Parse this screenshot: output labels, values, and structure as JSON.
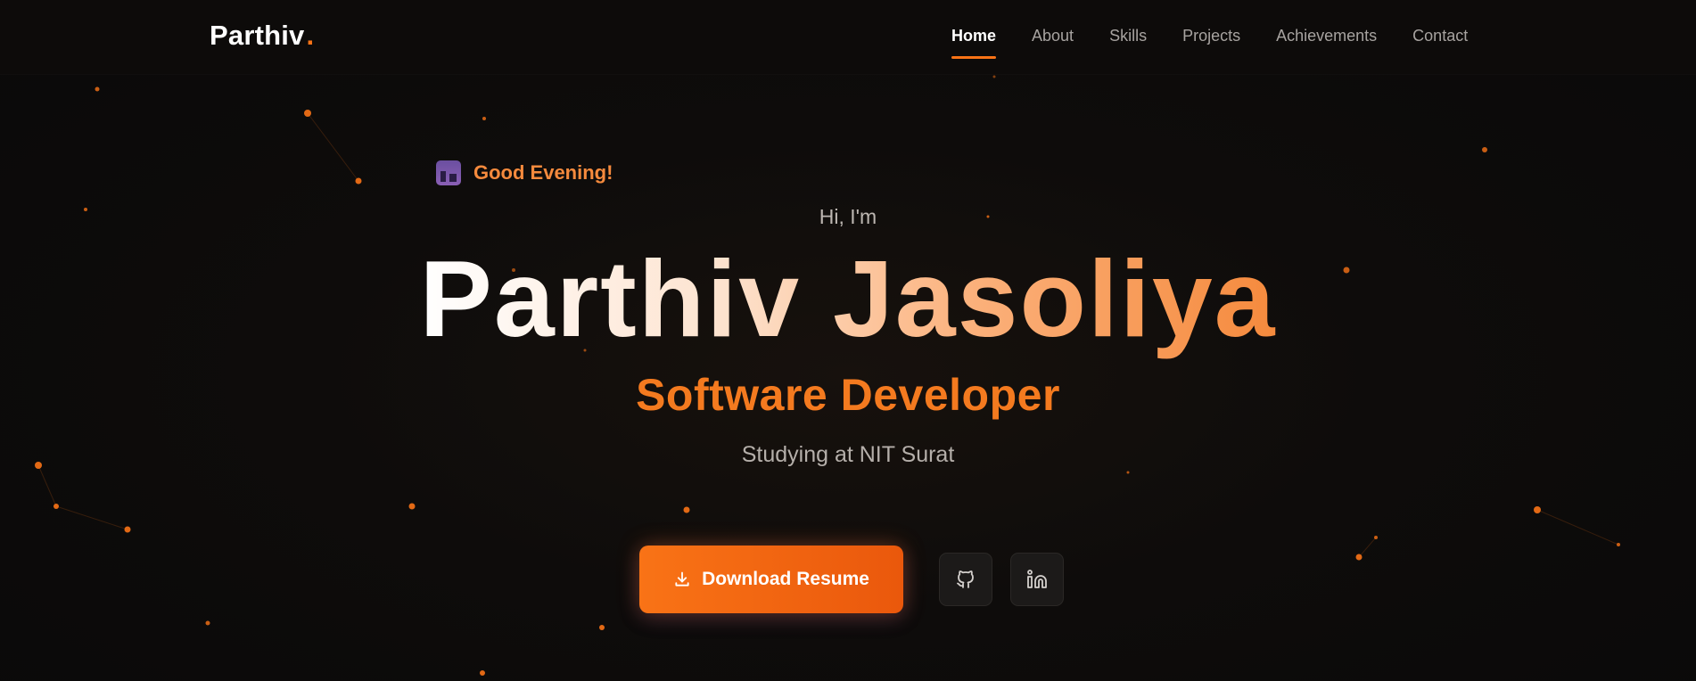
{
  "nav": {
    "logo": "Parthiv",
    "logo_dot": ".",
    "links": [
      "Home",
      "About",
      "Skills",
      "Projects",
      "Achievements",
      "Contact"
    ],
    "active": "Home"
  },
  "hero": {
    "greeting": "Good Evening!",
    "greeting_icon": "night-city-icon",
    "intro": "Hi, I'm",
    "name": "Parthiv Jasoliya",
    "role": "Software Developer",
    "subtitle": "Studying at NIT Surat",
    "resume_button": "Download Resume",
    "socials": [
      "github-icon",
      "linkedin-icon"
    ]
  },
  "colors": {
    "accent": "#f97316",
    "background": "#0d0b0a",
    "nav_text": "#a7a3a0"
  }
}
